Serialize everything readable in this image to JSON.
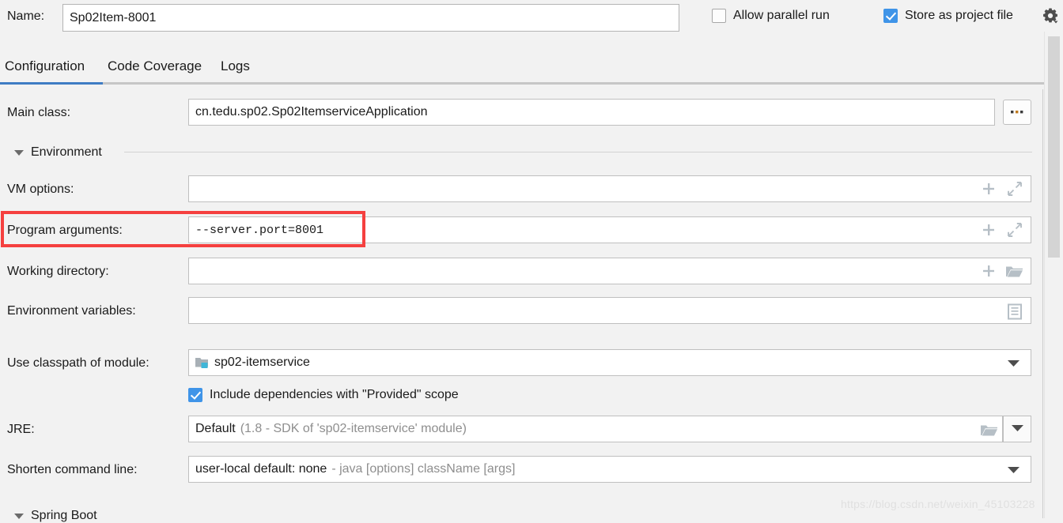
{
  "name_row": {
    "label": "Name:",
    "value": "Sp02Item-8001",
    "placeholder": "",
    "allow_parallel_run": {
      "label": "Allow parallel run",
      "checked": false
    },
    "store_as_project_file": {
      "label": "Store as project file",
      "checked": true
    },
    "gear_icon": "gear-icon"
  },
  "tabs": [
    {
      "label": "Configuration",
      "active": true
    },
    {
      "label": "Code Coverage",
      "active": false
    },
    {
      "label": "Logs",
      "active": false
    }
  ],
  "form": {
    "main_class": {
      "label": "Main class:",
      "value": "cn.tedu.sp02.Sp02ItemserviceApplication",
      "browse_label": "..."
    },
    "environment_section": {
      "title": "Environment"
    },
    "vm_options": {
      "label": "VM options:",
      "value": "",
      "icons": [
        "plus-icon",
        "expand-icon"
      ]
    },
    "program_arguments": {
      "label": "Program arguments:",
      "value": "--server.port=8001",
      "icons": [
        "plus-icon",
        "expand-icon"
      ],
      "highlighted": true,
      "highlight_color": "#f5403f"
    },
    "working_directory": {
      "label": "Working directory:",
      "value": "",
      "icons": [
        "plus-icon",
        "folder-icon"
      ]
    },
    "environment_variables": {
      "label": "Environment variables:",
      "value": "",
      "icons": [
        "list-icon"
      ]
    },
    "use_classpath_of_module": {
      "label": "Use classpath of module:",
      "value": "sp02-itemservice",
      "icon": "module-folder-icon",
      "dropdown_icon": "chevron-down-icon"
    },
    "include_provided_scope": {
      "label": "Include dependencies with \"Provided\" scope",
      "checked": true
    },
    "jre": {
      "label": "JRE:",
      "value": "Default",
      "value_detail": "(1.8 - SDK of 'sp02-itemservice' module)",
      "folder_icon": "folder-icon",
      "dropdown_icon": "chevron-down-icon"
    },
    "shorten_command_line": {
      "label": "Shorten command line:",
      "value": "user-local default: none",
      "value_detail": "- java [options] className [args]",
      "dropdown_icon": "chevron-down-icon"
    },
    "spring_boot_section": {
      "title": "Spring Boot"
    }
  },
  "scrollbar": {
    "name": "vertical-scrollbar"
  },
  "watermark": {
    "text": "https://blog.csdn.net/weixin_45103228"
  },
  "colors": {
    "accent_blue": "#3f94e8",
    "tab_active": "#3f7cc4",
    "highlight_red": "#f5403f",
    "background": "#f2f2f2"
  }
}
